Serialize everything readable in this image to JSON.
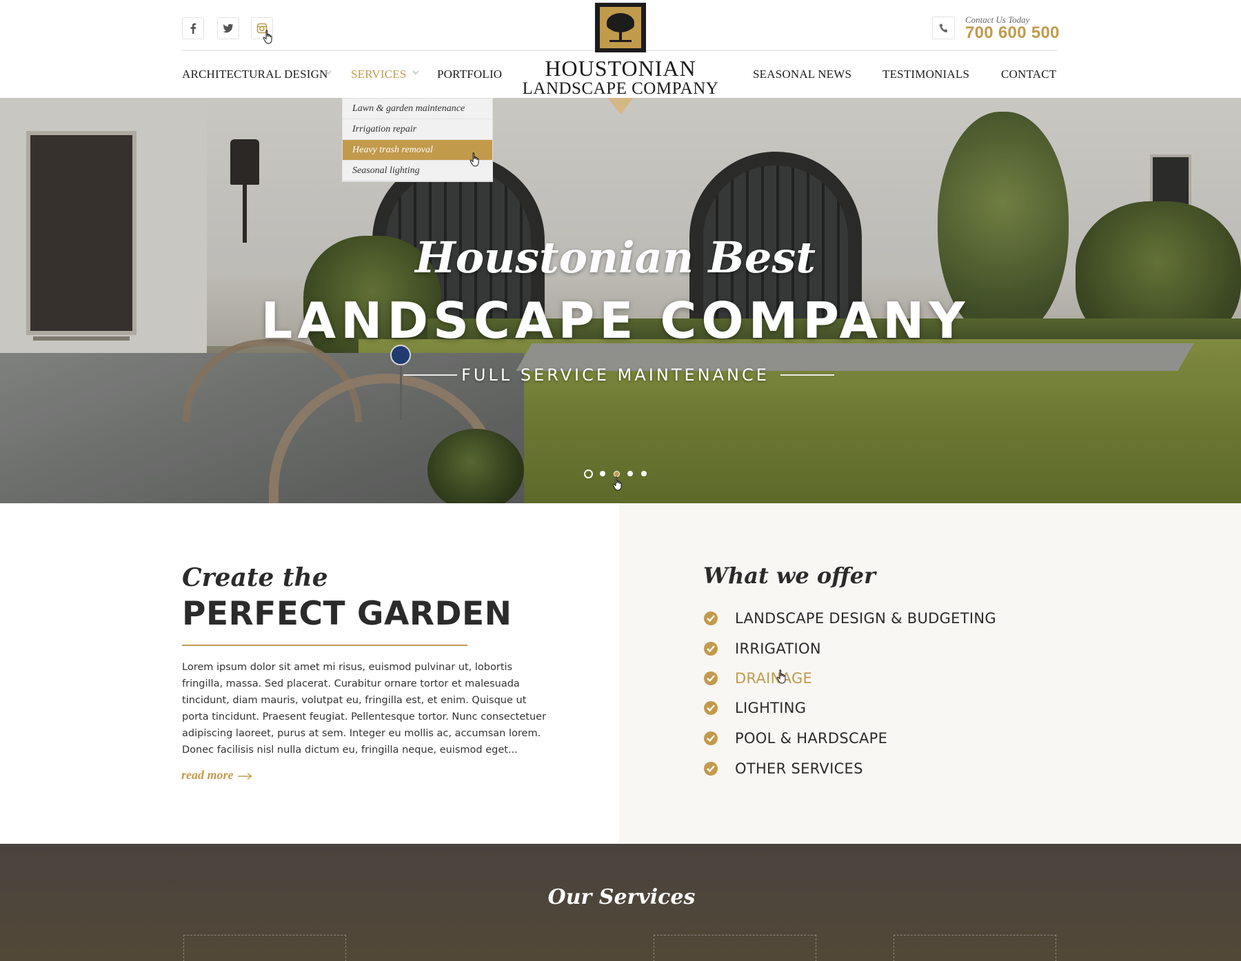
{
  "brand": {
    "line1": "HOUSTONIAN",
    "line2": "LANDSCAPE COMPANY"
  },
  "social": [
    {
      "name": "facebook",
      "icon": "facebook-icon"
    },
    {
      "name": "twitter",
      "icon": "twitter-icon"
    },
    {
      "name": "instagram",
      "icon": "instagram-icon"
    }
  ],
  "contact": {
    "label": "Contact Us Today",
    "phone": "700 600 500"
  },
  "nav": {
    "architectural": "ARCHITECTURAL DESIGN",
    "services": "SERVICES",
    "portfolio": "PORTFOLIO",
    "news": "SEASONAL NEWS",
    "testimonials": "TESTIMONIALS",
    "contact": "CONTACT"
  },
  "dropdown": {
    "items": [
      "Lawn & garden maintenance",
      "Irrigation repair",
      "Heavy trash removal",
      "Seasonal lighting"
    ],
    "highlighted_index": 2
  },
  "hero": {
    "title_script": "Houstonian Best",
    "title_main": "LANDSCAPE COMPANY",
    "subtitle": "FULL SERVICE MAINTENANCE",
    "slides": 5,
    "active_slide": 3
  },
  "intro": {
    "script": "Create the",
    "heading": "PERFECT GARDEN",
    "body": "Lorem ipsum dolor sit amet mi risus, euismod pulvinar ut, lobortis fringilla, massa. Sed placerat. Curabitur ornare tortor et malesuada tincidunt, diam mauris, volutpat eu, fringilla est, et enim. Quisque ut porta tincidunt. Praesent feugiat. Pellentesque tortor.  Nunc consectetuer adipiscing laoreet, purus at sem. Integer eu mollis ac, accumsan lorem. Donec facilisis nisl nulla dictum eu, fringilla neque, euismod eget...",
    "read_more": "read more"
  },
  "offer": {
    "title": "What we offer",
    "items": [
      "LANDSCAPE DESIGN & BUDGETING",
      "IRRIGATION",
      "DRAINAGE",
      "LIGHTING",
      "POOL & HARDSCAPE",
      "OTHER SERVICES"
    ],
    "highlighted_index": 2
  },
  "services": {
    "title": "Our Services"
  },
  "colors": {
    "accent": "#c29a4c",
    "dark": "#2b2b2b",
    "panel": "#f8f7f3",
    "band": "#4a433d"
  }
}
